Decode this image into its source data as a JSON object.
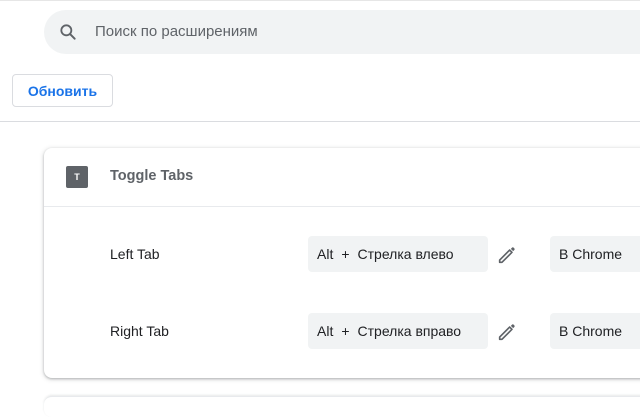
{
  "search": {
    "placeholder": "Поиск по расширениям",
    "icon": "search-icon"
  },
  "toolbar": {
    "update_label": "Обновить"
  },
  "extension": {
    "icon_letter": "T",
    "name": "Toggle Tabs",
    "shortcuts": [
      {
        "label": "Left Tab",
        "modifier": "Alt",
        "plus": "+",
        "key": "Стрелка влево",
        "scope": "В Chrome"
      },
      {
        "label": "Right Tab",
        "modifier": "Alt",
        "plus": "+",
        "key": "Стрелка вправо",
        "scope": "В Chrome"
      }
    ]
  },
  "colors": {
    "accent": "#1a73e8",
    "field_bg": "#f1f3f4",
    "muted_text": "#5f6368"
  }
}
